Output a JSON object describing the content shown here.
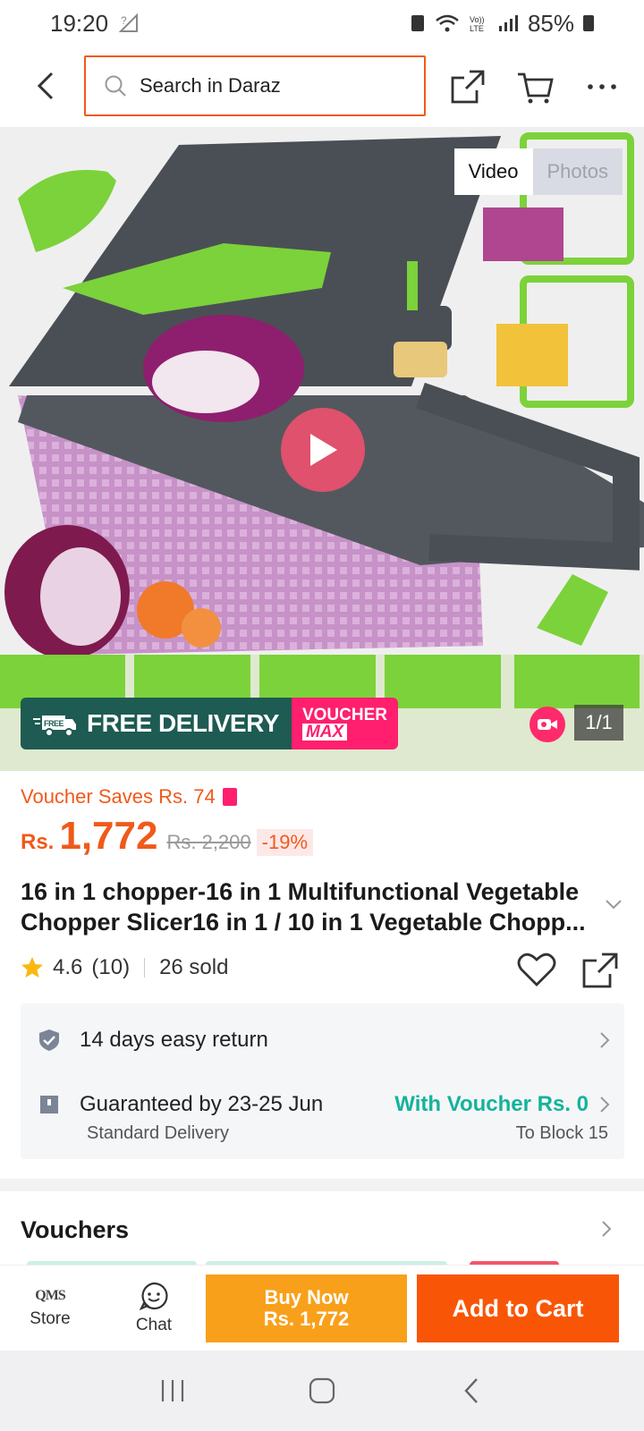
{
  "status_bar": {
    "time": "19:20",
    "battery": "85%"
  },
  "header": {
    "search_placeholder": "Search in Daraz"
  },
  "media": {
    "tabs": [
      {
        "label": "Video",
        "active": true
      },
      {
        "label": "Photos",
        "active": false
      }
    ],
    "promo_free_delivery": "FREE DELIVERY",
    "promo_free_small": "FREE",
    "promo_voucher_top": "VOUCHER",
    "promo_voucher_bottom": "MAX",
    "counter": "1/1"
  },
  "product": {
    "voucher_saves": "Voucher Saves Rs. 74",
    "currency": "Rs.",
    "price": "1,772",
    "original_price": "Rs. 2,200",
    "discount": "-19%",
    "title": "16 in 1 chopper-16 in 1 Multifunctional Vegetable Chopper Slicer16 in 1 / 10 in 1 Vegetable Chopp...",
    "rating": "4.6",
    "rating_count": "(10)",
    "sold": "26 sold"
  },
  "info": {
    "return_text": "14 days easy return",
    "delivery_text": "Guaranteed by 23-25 Jun",
    "delivery_voucher": "With Voucher Rs. 0",
    "delivery_type": "Standard Delivery",
    "delivery_location": "To Block 15"
  },
  "vouchers": {
    "title": "Vouchers"
  },
  "action_bar": {
    "store_logo": "QMS",
    "store_label": "Store",
    "chat_label": "Chat",
    "buy_now_line1": "Buy Now",
    "buy_now_line2": "Rs. 1,772",
    "add_to_cart": "Add to Cart"
  },
  "colors": {
    "brand": "#f85606",
    "buy_now": "#f9a01b",
    "accent_teal": "#14b39b",
    "voucher_pink": "#ff1f6e"
  }
}
